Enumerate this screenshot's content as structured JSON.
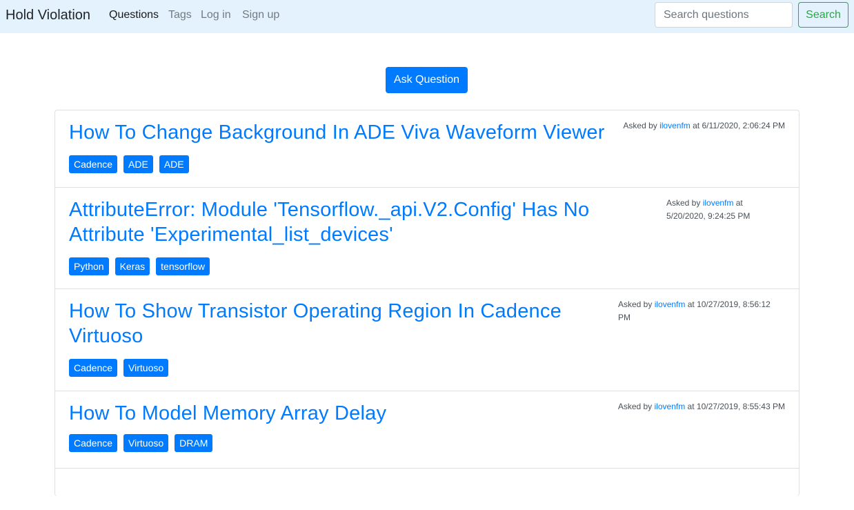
{
  "navbar": {
    "brand": "Hold Violation",
    "links": [
      {
        "label": "Questions"
      },
      {
        "label": "Tags"
      },
      {
        "label": "Log in"
      },
      {
        "label": "Sign up"
      }
    ],
    "search_placeholder": "Search questions",
    "search_button": "Search"
  },
  "ask_button": "Ask Question",
  "questions": [
    {
      "title": "How To Change Background In ADE Viva Waveform Viewer",
      "tags": [
        "Cadence",
        "ADE",
        "ADE"
      ],
      "meta_prefix": "Asked by",
      "user": "ilovenfm",
      "meta_suffix": "at 6/11/2020, 2:06:24 PM"
    },
    {
      "title_line1": "AttributeError: Module 'Tensorflow._api.V2.Config' Has No",
      "title_line2": "Attribute 'Experimental_list_devices'",
      "tags": [
        "Python",
        "Keras",
        "tensorflow"
      ],
      "meta_prefix": "Asked by",
      "user": "ilovenfm",
      "meta_suffix_line1": "at",
      "meta_suffix_line2": "5/20/2020, 9:24:25 PM"
    },
    {
      "title_line1": "How To Show Transistor Operating Region In Cadence",
      "title_line2": "Virtuoso",
      "tags": [
        "Cadence",
        "Virtuoso"
      ],
      "meta_prefix": "Asked by",
      "user": "ilovenfm",
      "meta_suffix_line1": "at 10/27/2019, 8:56:12",
      "meta_suffix_line2": "PM"
    },
    {
      "title": "How To Model Memory Array Delay",
      "tags": [
        "Cadence",
        "Virtuoso",
        "DRAM"
      ],
      "meta_prefix": "Asked by",
      "user": "ilovenfm",
      "meta_suffix": "at 10/27/2019, 8:55:43 PM"
    }
  ]
}
